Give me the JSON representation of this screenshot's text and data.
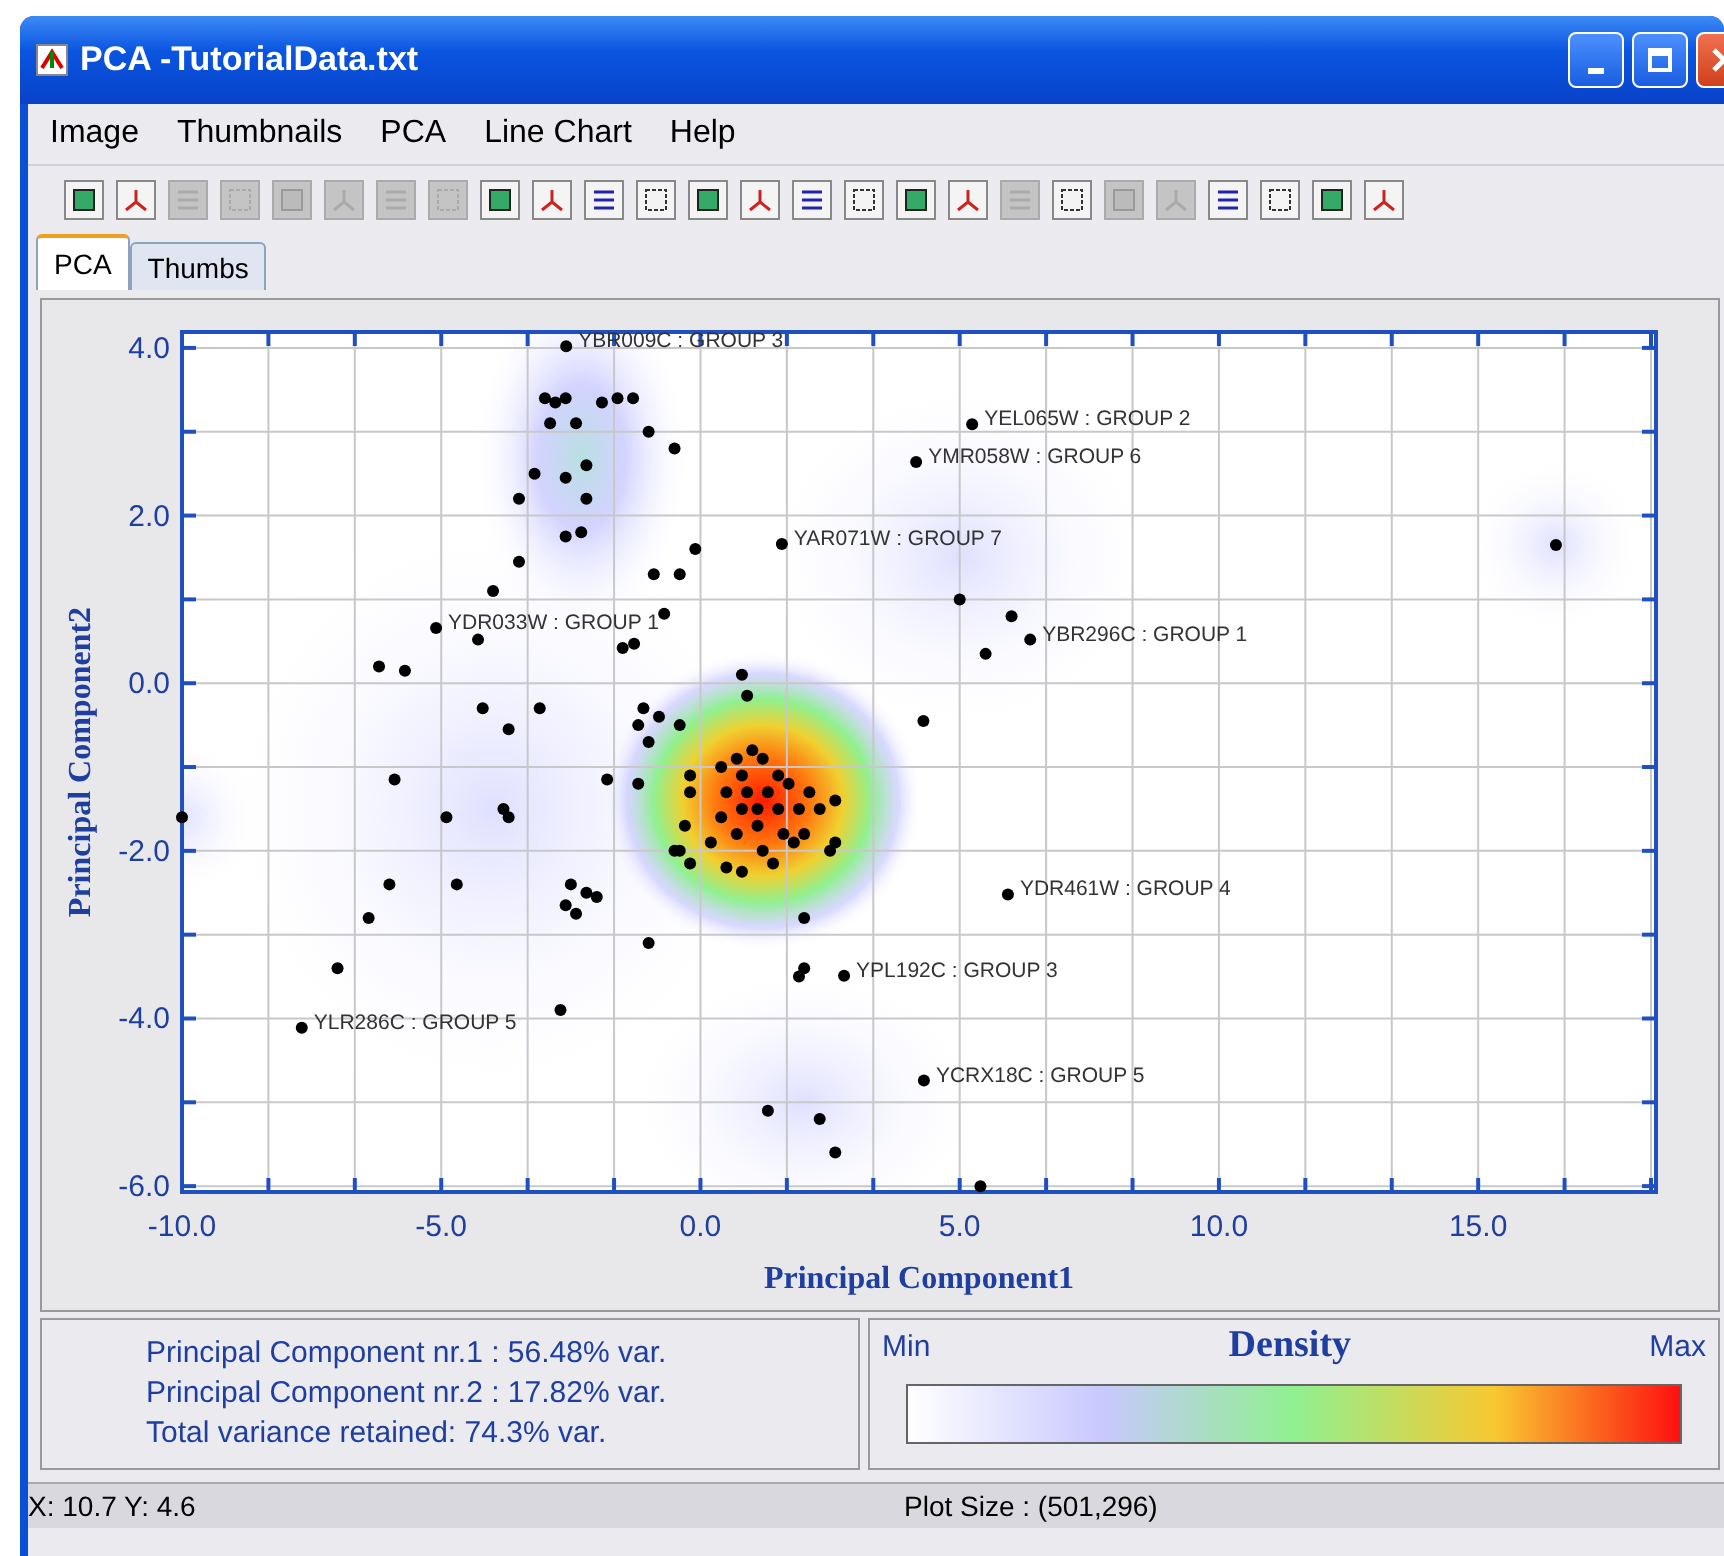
{
  "window": {
    "title": "PCA -TutorialData.txt"
  },
  "menu": [
    "Image",
    "Thumbnails",
    "PCA",
    "Line Chart",
    "Help"
  ],
  "toolbar": [
    {
      "disabled": false
    },
    {
      "disabled": false
    },
    {
      "disabled": true
    },
    {
      "disabled": true
    },
    {
      "disabled": true
    },
    {
      "disabled": true
    },
    {
      "disabled": true
    },
    {
      "disabled": true
    },
    {
      "disabled": false
    },
    {
      "disabled": false
    },
    {
      "disabled": false
    },
    {
      "disabled": false
    },
    {
      "disabled": false
    },
    {
      "disabled": false
    },
    {
      "disabled": false
    },
    {
      "disabled": false
    },
    {
      "disabled": false
    },
    {
      "disabled": false
    },
    {
      "disabled": true
    },
    {
      "disabled": false
    },
    {
      "disabled": true
    },
    {
      "disabled": true
    },
    {
      "disabled": false
    },
    {
      "disabled": false
    },
    {
      "disabled": false
    },
    {
      "disabled": false
    }
  ],
  "tabs": [
    {
      "label": "PCA",
      "selected": true
    },
    {
      "label": "Thumbs",
      "selected": false
    }
  ],
  "chart": {
    "chart_data": {
      "type": "scatter",
      "grid": true,
      "xlabel": "Principal Component1",
      "ylabel": "Principal Component2",
      "xlim": [
        -10,
        18.43
      ],
      "ylim": [
        -6.07,
        4.19
      ],
      "xticks": [
        {
          "value": -10,
          "label": "-10.0"
        },
        {
          "value": -5,
          "label": "-5.0"
        },
        {
          "value": 0,
          "label": "0.0"
        },
        {
          "value": 5,
          "label": "5.0"
        },
        {
          "value": 10,
          "label": "10.0"
        },
        {
          "value": 15,
          "label": "15.0"
        }
      ],
      "yticks": [
        {
          "value": 4,
          "label": "4.0"
        },
        {
          "value": 2,
          "label": "2.0"
        },
        {
          "value": 0,
          "label": "0.0"
        },
        {
          "value": -2,
          "label": "-2.0"
        },
        {
          "value": -4,
          "label": "-4.0"
        },
        {
          "value": -6,
          "label": "-6.0"
        }
      ],
      "x": [
        -2.59,
        5.24,
        4.16,
        1.57,
        -5.1,
        6.36,
        5.93,
        2.77,
        -7.69,
        4.31,
        -3.0,
        -2.8,
        -2.6,
        -1.6,
        -1.3,
        -2.9,
        -2.4,
        -1.9,
        -1.0,
        -0.5,
        -3.2,
        -2.6,
        -2.2,
        -3.5,
        -2.2,
        -2.6,
        -2.3,
        -0.1,
        -3.5,
        -4.0,
        -0.9,
        -0.4,
        -0.7,
        -1.28,
        -1.5,
        -4.29,
        -6.2,
        -5.7,
        -4.2,
        -3.7,
        -3.1,
        -1.1,
        -1.2,
        -0.8,
        -0.4,
        -1.0,
        0.8,
        0.9,
        -5.9,
        -4.9,
        -3.8,
        -3.7,
        -1.8,
        -1.2,
        -0.2,
        -0.2,
        -0.3,
        -0.4,
        -0.2,
        4.3,
        5.0,
        6.0,
        5.5,
        16.5,
        -10.0,
        0.4,
        0.7,
        1.0,
        1.2,
        0.8,
        1.5,
        0.5,
        0.9,
        1.3,
        1.7,
        2.1,
        0.4,
        0.8,
        1.1,
        1.5,
        1.9,
        2.3,
        0.7,
        1.1,
        1.6,
        2.0,
        0.2,
        1.2,
        1.8,
        2.6,
        2.5,
        0.5,
        0.8,
        1.4,
        -0.5,
        2.6,
        -6.0,
        -4.7,
        -2.5,
        -2.2,
        -2.6,
        -2.4,
        -2.0,
        -6.4,
        -1.0,
        -7.0,
        -2.7,
        2.0,
        2.0,
        1.9,
        1.3,
        2.3,
        2.6,
        5.4
      ],
      "series": [
        {
          "color": "#000000",
          "values": [
            4.02,
            3.09,
            2.64,
            1.66,
            0.66,
            0.52,
            -2.52,
            -3.49,
            -4.11,
            -4.74,
            3.4,
            3.35,
            3.4,
            3.4,
            3.4,
            3.1,
            3.1,
            3.35,
            3.0,
            2.8,
            2.5,
            2.45,
            2.6,
            2.2,
            2.2,
            1.75,
            1.8,
            1.6,
            1.45,
            1.1,
            1.3,
            1.3,
            0.83,
            0.47,
            0.42,
            0.52,
            0.2,
            0.15,
            -0.3,
            -0.55,
            -0.3,
            -0.3,
            -0.5,
            -0.4,
            -0.5,
            -0.7,
            0.1,
            -0.15,
            -1.15,
            -1.6,
            -1.5,
            -1.6,
            -1.15,
            -1.2,
            -1.1,
            -1.3,
            -1.7,
            -2.0,
            -2.15,
            -0.45,
            1.0,
            0.8,
            0.35,
            1.65,
            -1.6,
            -1.0,
            -0.9,
            -0.8,
            -0.9,
            -1.1,
            -1.1,
            -1.3,
            -1.3,
            -1.3,
            -1.2,
            -1.3,
            -1.6,
            -1.5,
            -1.5,
            -1.5,
            -1.5,
            -1.5,
            -1.8,
            -1.7,
            -1.8,
            -1.8,
            -1.9,
            -2.0,
            -1.9,
            -1.4,
            -2.0,
            -2.2,
            -2.25,
            -2.15,
            -2.0,
            -1.9,
            -2.4,
            -2.4,
            -2.4,
            -2.5,
            -2.65,
            -2.75,
            -2.55,
            -2.8,
            -3.1,
            -3.4,
            -3.9,
            -2.8,
            -3.4,
            -3.5,
            -5.1,
            -5.2,
            -5.6,
            -6.0
          ]
        }
      ],
      "annotations": [
        {
          "text": "YBR009C : GROUP 3",
          "x": -2.59,
          "y": 4.02
        },
        {
          "text": "YEL065W : GROUP 2",
          "x": 5.24,
          "y": 3.09
        },
        {
          "text": "YMR058W : GROUP 6",
          "x": 4.16,
          "y": 2.64
        },
        {
          "text": "YAR071W : GROUP 7",
          "x": 1.57,
          "y": 1.66
        },
        {
          "text": "YDR033W : GROUP 1",
          "x": -5.1,
          "y": 0.66
        },
        {
          "text": "YBR296C : GROUP 1",
          "x": 6.36,
          "y": 0.52
        },
        {
          "text": "YDR461W : GROUP 4",
          "x": 5.93,
          "y": -2.52
        },
        {
          "text": "YPL192C : GROUP 3",
          "x": 2.77,
          "y": -3.49
        },
        {
          "text": "YLR286C : GROUP 5",
          "x": -7.69,
          "y": -4.11
        },
        {
          "text": "YCRX18C : GROUP 5",
          "x": 4.31,
          "y": -4.74
        }
      ]
    }
  },
  "variance_info": [
    "Principal Component nr.1 : 56.48% var.",
    "Principal Component nr.2 : 17.82% var.",
    "Total variance retained: 74.3% var."
  ],
  "density_legend": {
    "title": "Density",
    "min_label": "Min",
    "max_label": "Max"
  },
  "status_bar": {
    "coordinates": "X: 10.7 Y: 4.6",
    "plot_size": "Plot Size : (501,296)"
  }
}
